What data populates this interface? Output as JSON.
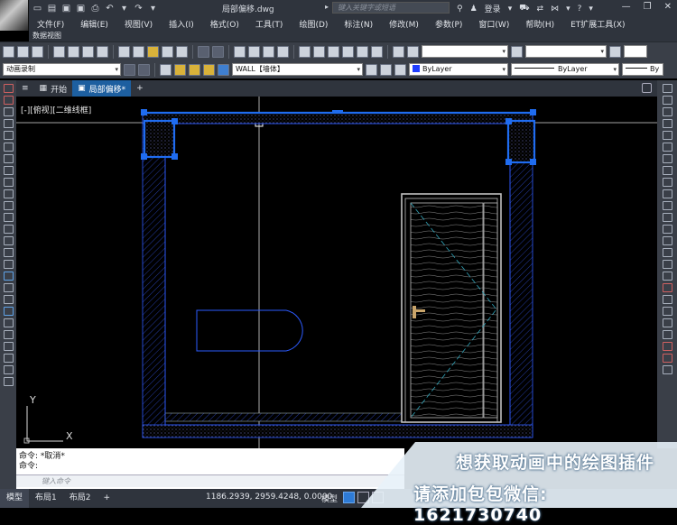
{
  "app": {
    "document_title": "局部偏移.dwg",
    "search_placeholder": "键入关键字或短语",
    "login_label": "登录"
  },
  "menu": {
    "items": [
      "文件(F)",
      "编辑(E)",
      "视图(V)",
      "插入(I)",
      "格式(O)",
      "工具(T)",
      "绘图(D)",
      "标注(N)",
      "修改(M)",
      "参数(P)",
      "窗口(W)",
      "帮助(H)",
      "ET扩展工具(X)"
    ],
    "row2": "数据视图"
  },
  "toolbar": {
    "workspace": "动画录制",
    "layer_name": "WALL【墙体】",
    "color": "ByLayer",
    "linetype": "ByLayer",
    "lineweight": "By"
  },
  "tabs": {
    "menu_icon": "≡",
    "start": "开始",
    "drawing": "局部偏移*",
    "add": "+"
  },
  "viewport": {
    "label": "[-][俯视][二维线框]",
    "ucs_x": "X",
    "ucs_y": "Y"
  },
  "command": {
    "line1": "命令: *取消*",
    "line2": "命令:",
    "placeholder": "键入命令"
  },
  "status": {
    "layout_tabs": [
      "模型",
      "布局1",
      "布局2"
    ],
    "add_layout": "+",
    "coordinates": "1186.2939, 2959.4248, 0.0000",
    "model_label": "模型"
  },
  "promo": {
    "line1": "想获取动画中的绘图插件",
    "line2": "请添加包包微信: 1621730740"
  },
  "colors": {
    "accent": "#1d5fa0",
    "cad_blue": "#2d5bff",
    "grip_blue": "#1f6cf0",
    "viewport_bg": "#000000"
  }
}
